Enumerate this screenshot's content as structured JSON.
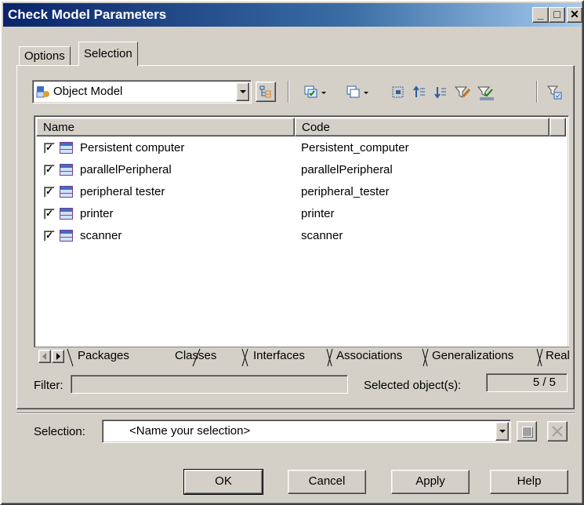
{
  "window": {
    "title": "Check Model Parameters",
    "controls": {
      "minimize": "_",
      "maximize": "□",
      "close": "✕"
    }
  },
  "tabs": [
    {
      "label": "Options",
      "active": false
    },
    {
      "label": "Selection",
      "active": true
    }
  ],
  "model_combo": {
    "value": "Object Model",
    "icon": "object-model-icon"
  },
  "toolbar": {
    "icons": [
      "hierarchy-icon",
      "select-all-icon",
      "deselect-all-icon",
      "include-subobjects-icon",
      "move-up-icon",
      "move-down-icon",
      "filter-icon",
      "filter-selection-icon",
      "use-graphical-selection-icon"
    ]
  },
  "grid": {
    "columns": [
      "Name",
      "Code"
    ],
    "rows": [
      {
        "checked": true,
        "name": "Persistent computer",
        "code": "Persistent_computer"
      },
      {
        "checked": true,
        "name": "parallelPeripheral",
        "code": "parallelPeripheral"
      },
      {
        "checked": true,
        "name": "peripheral tester",
        "code": "peripheral_tester"
      },
      {
        "checked": true,
        "name": "printer",
        "code": "printer"
      },
      {
        "checked": true,
        "name": "scanner",
        "code": "scanner"
      }
    ]
  },
  "sheet_tabs": [
    "Packages",
    "Classes",
    "Interfaces",
    "Associations",
    "Generalizations",
    "Realizat"
  ],
  "active_sheet": "Classes",
  "filter": {
    "label": "Filter:",
    "value": ""
  },
  "selected_objects": {
    "label": "Selected object(s):",
    "value": "5 / 5"
  },
  "selection": {
    "label": "Selection:",
    "value": "<Name your selection>"
  },
  "buttons": {
    "ok": "OK",
    "cancel": "Cancel",
    "apply": "Apply",
    "help": "Help"
  },
  "colors": {
    "title_start": "#0a246a",
    "title_end": "#a6caf0",
    "face": "#d4d0c8"
  }
}
